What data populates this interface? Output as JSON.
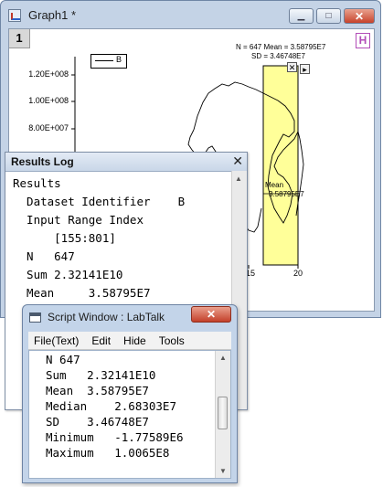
{
  "graph_window": {
    "title": "Graph1 *",
    "layer_number": "1",
    "h_badge": "H",
    "legend_label": "B",
    "y_ticks": [
      "1.20E+008",
      "1.00E+008",
      "8.00E+007"
    ],
    "x_ticks": [
      "15",
      "20"
    ],
    "stats_line1": "N = 647 Mean = 3.58795E7",
    "stats_line2": "SD = 3.46748E7",
    "mean_label": "Mean",
    "mean_value": "3.58795E7",
    "highlight_color": "#ffff99"
  },
  "results_log": {
    "title": "Results Log",
    "lines": [
      "Results",
      "  Dataset Identifier    B",
      "  Input Range Index",
      "      [155:801]",
      "  N   647",
      "  Sum 2.32141E10",
      "  Mean     3.58795E7"
    ]
  },
  "script_window": {
    "title": "Script Window : LabTalk",
    "menu": [
      "File(Text)",
      "Edit",
      "Hide",
      "Tools"
    ],
    "lines": [
      "N 647",
      "Sum   2.32141E10",
      "Mean  3.58795E7",
      "Median    2.68303E7",
      "SD    3.46748E7",
      "Minimum   -1.77589E6",
      "Maximum   1.0065E8"
    ]
  }
}
